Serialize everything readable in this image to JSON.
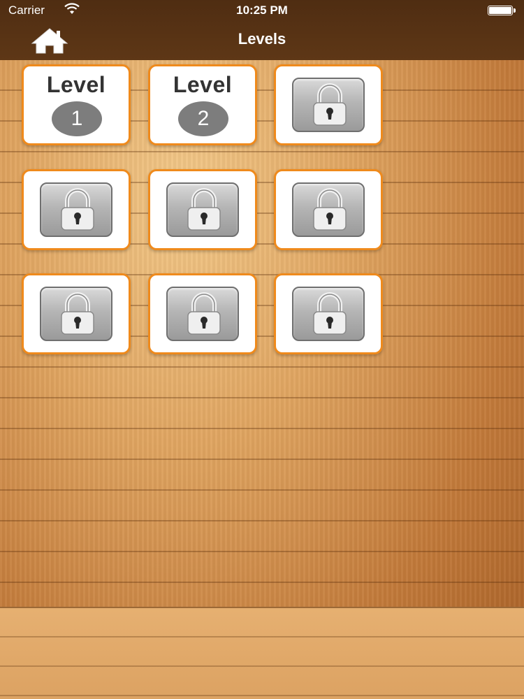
{
  "status_bar": {
    "carrier": "Carrier",
    "time": "10:25 PM"
  },
  "nav": {
    "title": "Levels",
    "home_icon": "home-icon"
  },
  "levels": [
    {
      "label": "Level",
      "number": "1",
      "locked": false
    },
    {
      "label": "Level",
      "number": "2",
      "locked": false
    },
    {
      "locked": true,
      "icon": "padlock-icon"
    },
    {
      "locked": true,
      "icon": "padlock-icon"
    },
    {
      "locked": true,
      "icon": "padlock-icon"
    },
    {
      "locked": true,
      "icon": "padlock-icon"
    },
    {
      "locked": true,
      "icon": "padlock-icon"
    },
    {
      "locked": true,
      "icon": "padlock-icon"
    },
    {
      "locked": true,
      "icon": "padlock-icon"
    }
  ],
  "colors": {
    "nav_background": "#5a3415",
    "tile_border": "#ef8a1c",
    "level_badge": "#7d7d7d"
  }
}
